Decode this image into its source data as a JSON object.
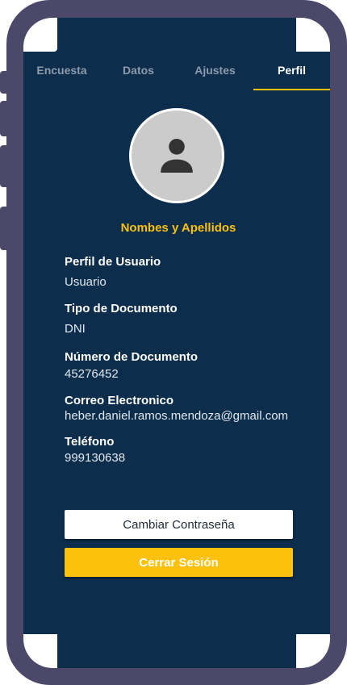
{
  "tabs": [
    {
      "label": "Encuesta"
    },
    {
      "label": "Datos"
    },
    {
      "label": "Ajustes"
    },
    {
      "label": "Perfil"
    }
  ],
  "profile": {
    "full_name": "Nombes y Apellidos",
    "avatar_icon": "person-icon"
  },
  "fields": {
    "perfil": {
      "label": "Perfil de Usuario",
      "value": "Usuario"
    },
    "tipo_documento": {
      "label": "Tipo de Documento",
      "value": "DNI"
    },
    "numero_documento": {
      "label": "Número de Documento",
      "value": "45276452"
    },
    "correo": {
      "label": "Correo Electronico",
      "value": "heber.daniel.ramos.mendoza@gmail.com"
    },
    "telefono": {
      "label": "Teléfono",
      "value": "999130638"
    }
  },
  "actions": {
    "change_password": "Cambiar Contraseña",
    "logout": "Cerrar Sesión"
  },
  "colors": {
    "background": "#0c2d4c",
    "accent": "#fcc10c",
    "frame": "#4c4869"
  }
}
